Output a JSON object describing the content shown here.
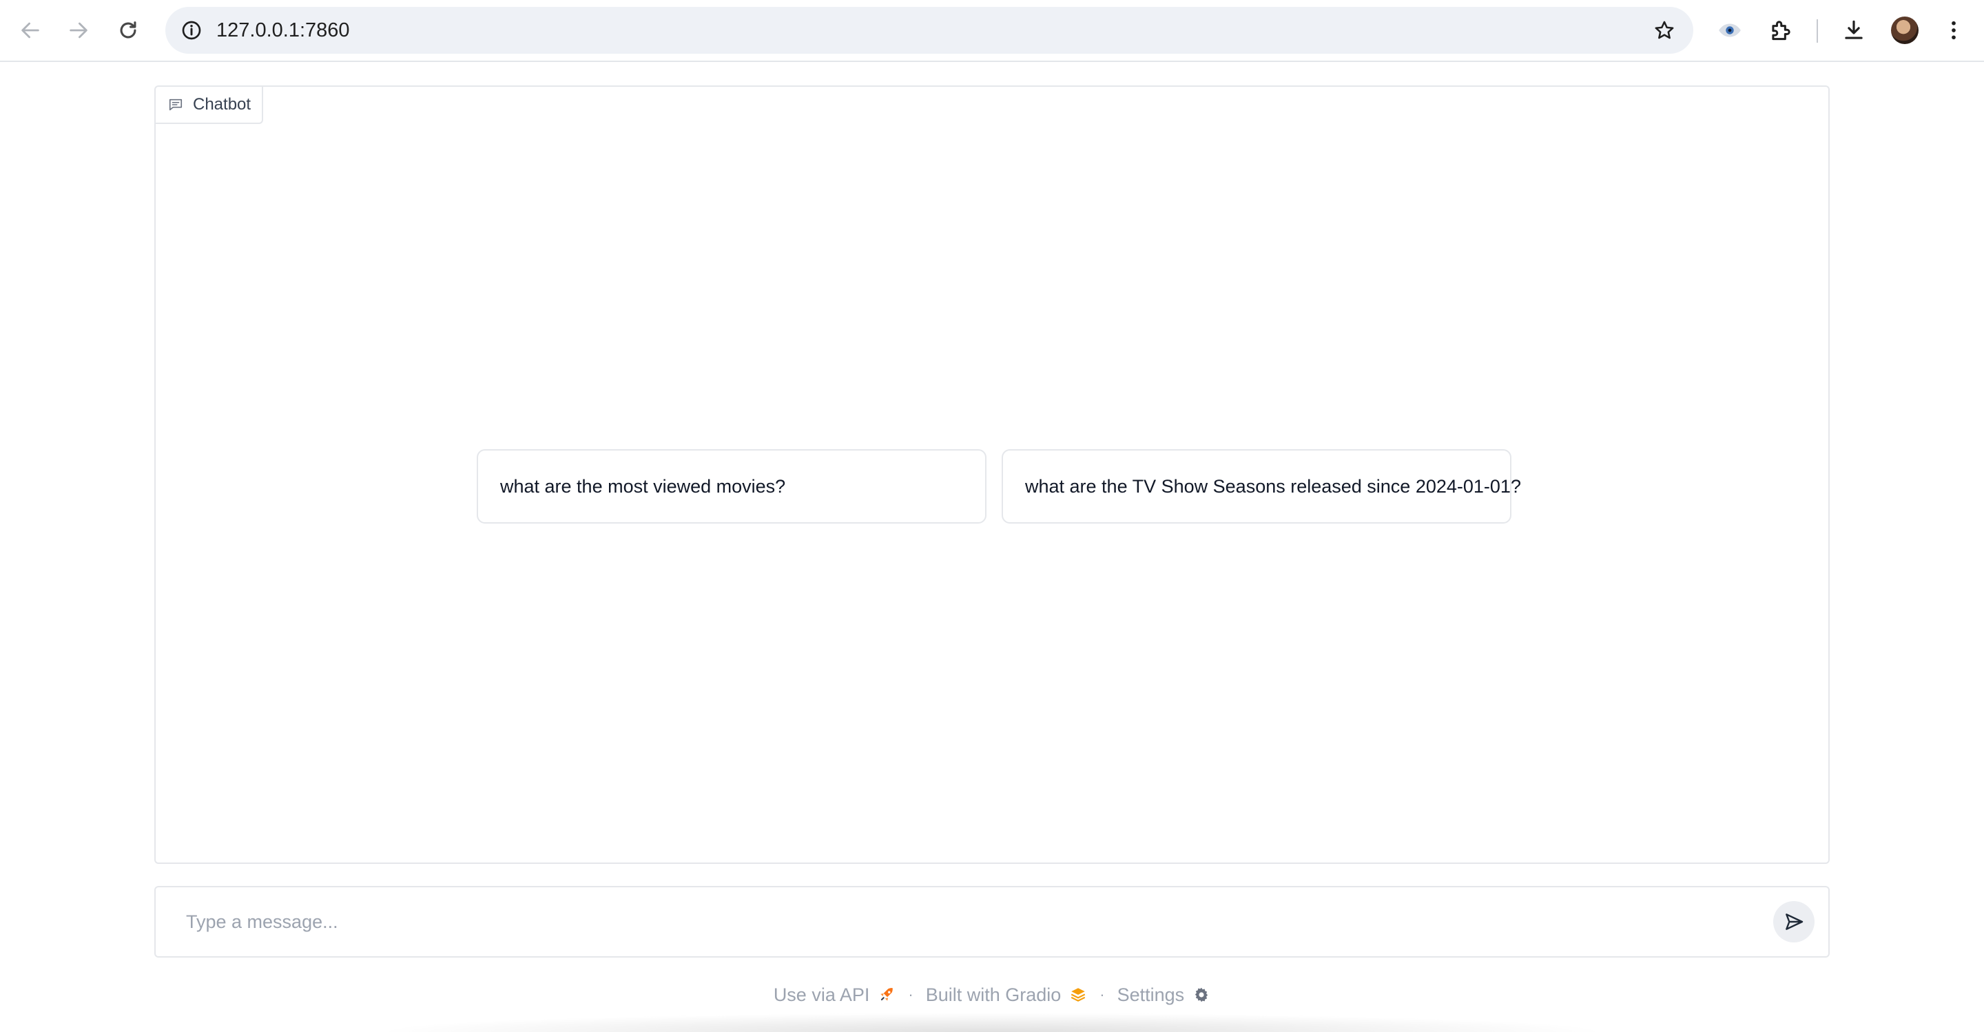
{
  "browser": {
    "url": "127.0.0.1:7860"
  },
  "chatbot": {
    "label": "Chatbot",
    "examples": [
      "what are the most viewed movies?",
      "what are the TV Show Seasons released since 2024-01-01?"
    ]
  },
  "composer": {
    "placeholder": "Type a message...",
    "value": ""
  },
  "footer": {
    "api_label": "Use via API",
    "built_label": "Built with Gradio",
    "settings_label": "Settings",
    "separator": "·"
  },
  "colors": {
    "gradio_orange": "#f59e0b",
    "border": "#e5e7eb",
    "muted_text": "#9ca3af"
  }
}
